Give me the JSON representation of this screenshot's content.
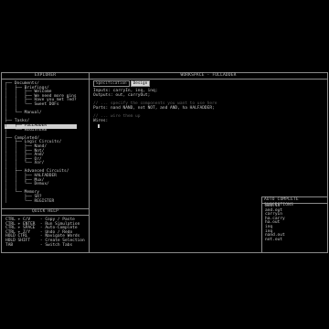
{
  "explorer": {
    "title": "EXPLORER",
    "items": [
      {
        "text": "┌── Documents/",
        "selected": false
      },
      {
        "text": "│   ├── Briefings/",
        "selected": false
      },
      {
        "text": "│   │   ├── Welcome",
        "selected": false
      },
      {
        "text": "│   │   ├── We need more gins",
        "selected": false
      },
      {
        "text": "│   │   ├── Have you met Ted?",
        "selected": false
      },
      {
        "text": "│   │   └── Sweet DOFs",
        "selected": false
      },
      {
        "text": "│   │",
        "selected": false
      },
      {
        "text": "│   └── Manual/",
        "selected": false
      },
      {
        "text": "│",
        "selected": false
      },
      {
        "text": "├── Tasks/",
        "selected": false
      },
      {
        "text": "│   ├── FULLADDER",
        "selected": true
      },
      {
        "text": "│   └── REGISTER8",
        "selected": false
      },
      {
        "text": "│",
        "selected": false
      },
      {
        "text": "├── Completed/",
        "selected": false
      },
      {
        "text": "│   ├── Logic Circuits/",
        "selected": false
      },
      {
        "text": "│   │   ├── Nand/",
        "selected": false
      },
      {
        "text": "│   │   ├── Not/",
        "selected": false
      },
      {
        "text": "│   │   ├── And/",
        "selected": false
      },
      {
        "text": "│   │   ├── Or/",
        "selected": false
      },
      {
        "text": "│   │   └── Xor/",
        "selected": false
      },
      {
        "text": "│   │",
        "selected": false
      },
      {
        "text": "│   ├── Advanced Circuits/",
        "selected": false
      },
      {
        "text": "│   │   ├── HALFADDER",
        "selected": false
      },
      {
        "text": "│   │   ├── Mux/",
        "selected": false
      },
      {
        "text": "│   │   └── Demux/",
        "selected": false
      },
      {
        "text": "│   │",
        "selected": false
      },
      {
        "text": "│   └── Memory",
        "selected": false
      },
      {
        "text": "│       ├── SR?",
        "selected": false
      },
      {
        "text": "│       └── REGISTER",
        "selected": false
      }
    ]
  },
  "workspace": {
    "title": "WORKSPACE - FULLADDER",
    "tabs": [
      {
        "label": "Specification",
        "active": false
      },
      {
        "label": "Design",
        "active": true
      }
    ],
    "lines": [
      {
        "text": "Inputs: carryIn, inq, inq;",
        "comment": false
      },
      {
        "text": "Outputs: out, carryOut;",
        "comment": false
      },
      {
        "text": "",
        "comment": false
      },
      {
        "text": "// ... specify the components you want to use here",
        "comment": true
      },
      {
        "text": "Parts: nand NAND, not NOT, and AND, ha HALFADDER;",
        "comment": false
      },
      {
        "text": "",
        "comment": false
      },
      {
        "text": "// ... wire them up",
        "comment": true
      },
      {
        "text": "Wires:",
        "comment": false
      },
      {
        "text": "  ",
        "comment": false,
        "cursor": true
      }
    ]
  },
  "quick_help": {
    "title": "QUICK HELP",
    "lines": [
      "CTRL + C/V    - Copy / Paste",
      "CTRL + ENTER  - Run Simulation",
      "CTRL + SPACE  - Auto-Complete",
      "CTRL + Z/Y    - Undo / Redo",
      "HOLD CTRL     - Navigate Words",
      "HOLD SHIFT    - Create Selection",
      "TAB           - Switch Tabs"
    ]
  },
  "autocomplete": {
    "title": "AUTO COMPLETE SUGGESTIONS",
    "items": [
      "and.in",
      "and.out",
      "carryIn",
      "ha.carry",
      "ha.out",
      "inq",
      "inq",
      "nand.out",
      "not.out"
    ]
  }
}
